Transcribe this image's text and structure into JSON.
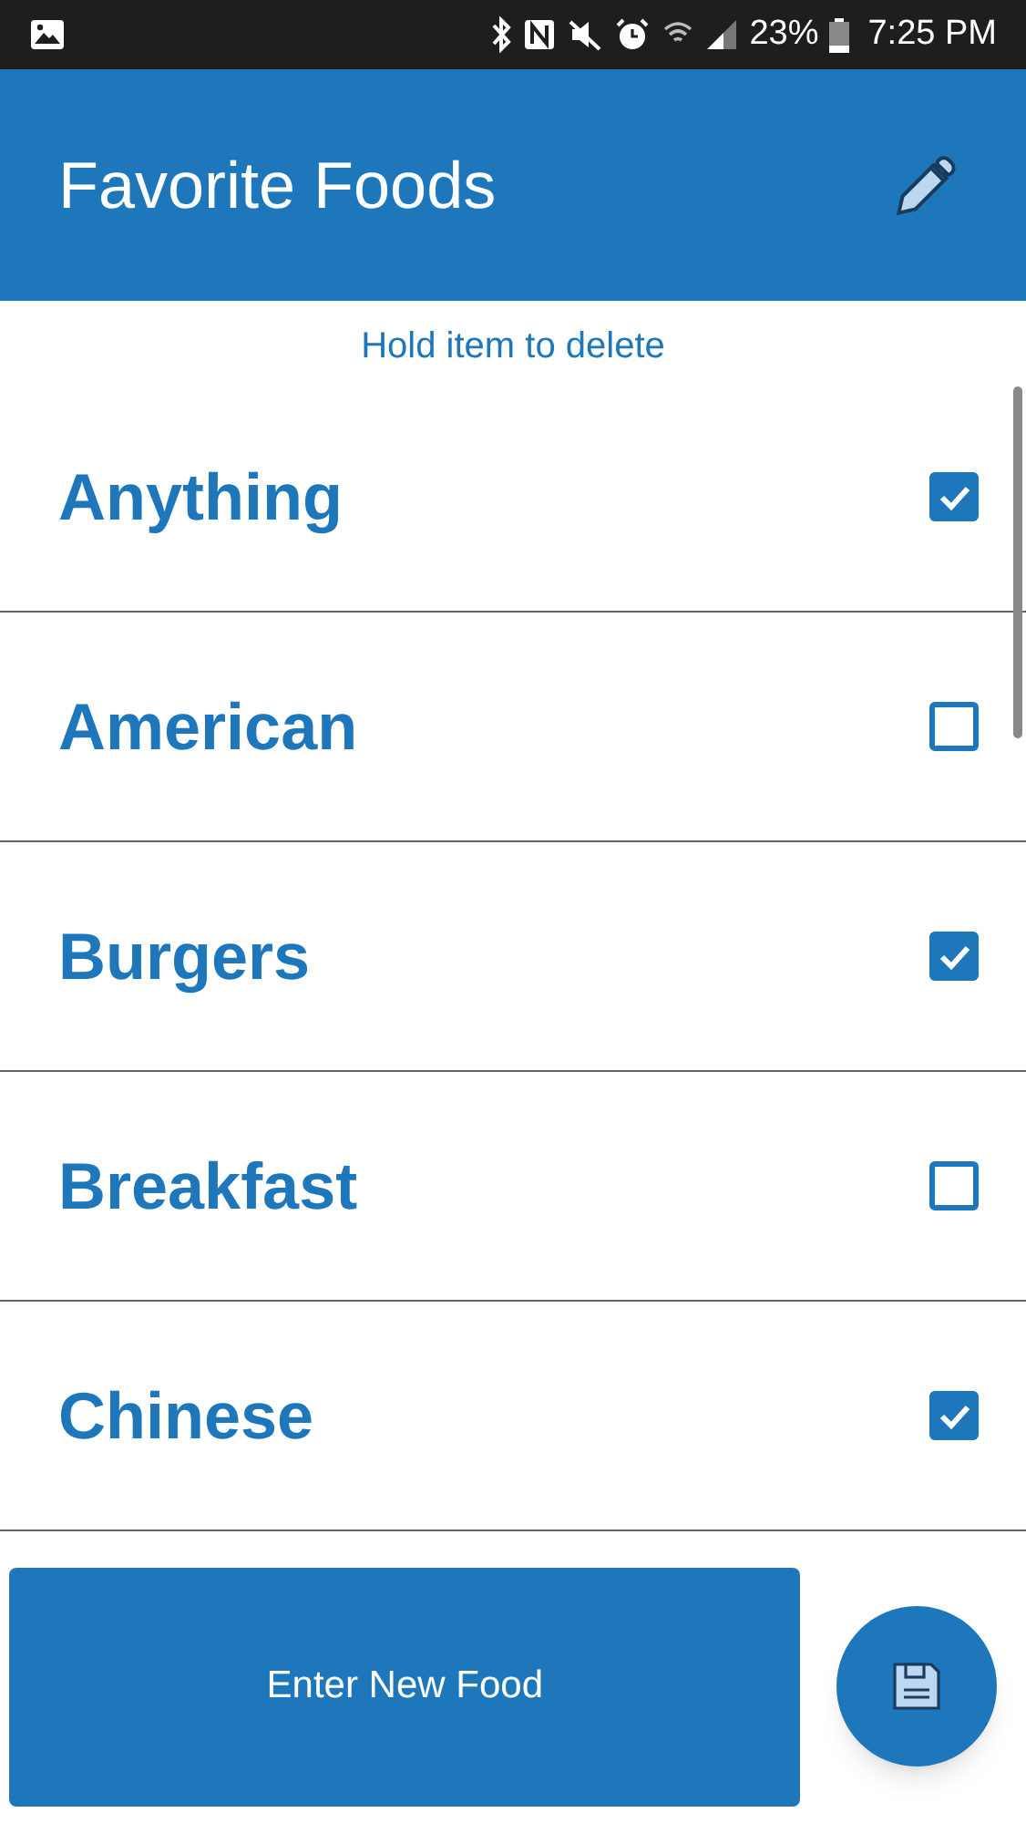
{
  "status_bar": {
    "battery": "23%",
    "time": "7:25 PM"
  },
  "app_bar": {
    "title": "Favorite Foods"
  },
  "hint": "Hold item to delete",
  "items": [
    {
      "label": "Anything",
      "checked": true
    },
    {
      "label": "American",
      "checked": false
    },
    {
      "label": "Burgers",
      "checked": true
    },
    {
      "label": "Breakfast",
      "checked": false
    },
    {
      "label": "Chinese",
      "checked": true
    }
  ],
  "new_food_button": "Enter New Food"
}
